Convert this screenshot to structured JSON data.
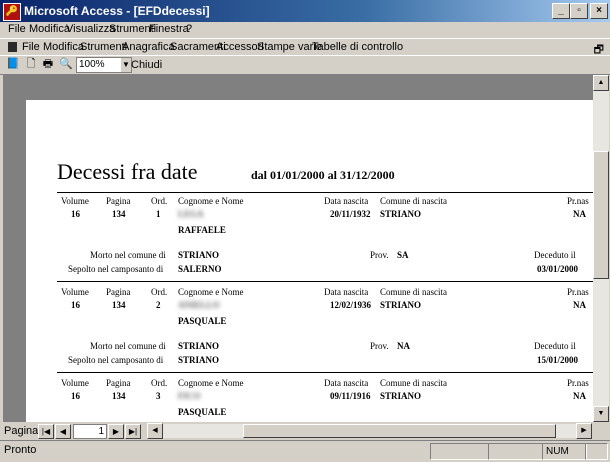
{
  "window": {
    "title": "Microsoft Access - [EFDdecessi]"
  },
  "menu1": [
    "File",
    "Modifica",
    "Visualizza",
    "Strumenti",
    "Finestra",
    "?"
  ],
  "menu2": [
    "File",
    "Modifica",
    "Strumenti",
    "Anagrafica",
    "Sacramenti",
    "Accessori",
    "Stampe varie",
    "Tabelle di controllo"
  ],
  "toolbar": {
    "zoom": "100%",
    "close_label": "Chiudi"
  },
  "report": {
    "title": "Decessi fra date",
    "range": "dal 01/01/2000 al 31/12/2000",
    "headers": {
      "volume": "Volume",
      "pagina": "Pagina",
      "ord": "Ord.",
      "cognome": "Cognome e Nome",
      "data_nascita": "Data nascita",
      "comune_nascita": "Comune di nascita",
      "prov_nascita": "Pr.nas"
    },
    "labels": {
      "morto": "Morto nel comune di",
      "prov": "Prov.",
      "sepolto": "Sepolto nel camposanto di",
      "deceduto": "Deceduto il"
    },
    "records": [
      {
        "volume": "16",
        "pagina": "134",
        "ord": "1",
        "cognome": "LEGA",
        "nome": "RAFFAELE",
        "data_nascita": "20/11/1932",
        "comune_nascita": "STRIANO",
        "prov_nascita": "NA",
        "morto": "STRIANO",
        "prov": "SA",
        "sepolto": "SALERNO",
        "deceduto": "03/01/2000"
      },
      {
        "volume": "16",
        "pagina": "134",
        "ord": "2",
        "cognome": "ANIELLO",
        "nome": "PASQUALE",
        "data_nascita": "12/02/1936",
        "comune_nascita": "STRIANO",
        "prov_nascita": "NA",
        "morto": "STRIANO",
        "prov": "NA",
        "sepolto": "STRIANO",
        "deceduto": "15/01/2000"
      },
      {
        "volume": "16",
        "pagina": "134",
        "ord": "3",
        "cognome": "FICO",
        "nome": "PASQUALE",
        "data_nascita": "09/11/1916",
        "comune_nascita": "STRIANO",
        "prov_nascita": "NA"
      }
    ]
  },
  "nav": {
    "label": "Pagina:",
    "page": "1"
  },
  "status": {
    "text": "Pronto",
    "num": "NUM"
  }
}
